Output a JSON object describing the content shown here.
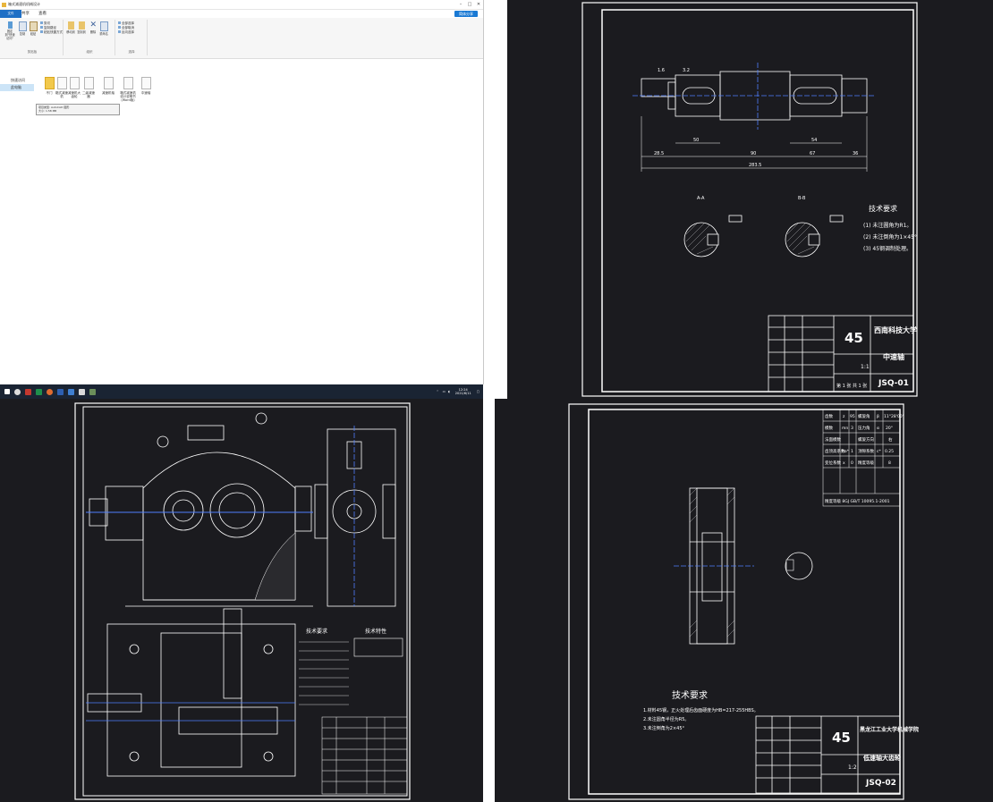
{
  "explorer": {
    "window_title": "箱式减速机机械设计",
    "menu": [
      "文件",
      "主页",
      "共享",
      "查看"
    ],
    "share_button": "简体分享",
    "ribbon": {
      "groups": [
        {
          "label": "剪贴板"
        },
        {
          "label": "组织"
        },
        {
          "label": "选择"
        }
      ],
      "buttons": {
        "pin": "固定到\"快速访问\"",
        "copy": "复制",
        "paste": "粘贴",
        "cut": "剪切",
        "copy_path": "复制路径",
        "paste_shortcut": "粘贴快捷方式",
        "move_to": "移动到",
        "copy_to": "复制到",
        "delete": "删除",
        "rename": "重命名",
        "select_all": "全部选择",
        "select_none": "全部取消",
        "invert_selection": "反向选择"
      }
    },
    "nav": [
      "快速访问",
      "此电脑"
    ],
    "files": [
      {
        "name": "不门",
        "type": "folder"
      },
      {
        "name": "箱式减速机",
        "type": "doc"
      },
      {
        "name": "减速机大齿轮",
        "type": "doc"
      },
      {
        "name": "二级减速器",
        "type": "doc"
      },
      {
        "name": "减速机轴",
        "type": "doc"
      },
      {
        "name": "箱式减速机设计说明书 (Word版)",
        "type": "doc"
      },
      {
        "name": "中速轴",
        "type": "doc"
      }
    ],
    "tooltip": [
      "项目类型: AutoCAD 图形",
      "大小: 1.58 MB",
      "修改日期: 2021/6/11 12:24"
    ]
  },
  "taskbar": {
    "time": "12:24",
    "date": "2021/6/11",
    "icons": [
      "windows-icon",
      "search-icon",
      "cad-icon",
      "excel-icon",
      "browser-icon",
      "word-icon",
      "autocad-icon",
      "folder-icon",
      "app-icon"
    ]
  },
  "shaft_drawing": {
    "material": "45",
    "school": "西南科技大学",
    "part_name": "中速轴",
    "drawing_no": "JSQ-01",
    "scale": "1:1",
    "requirements_title": "技术要求",
    "requirements": [
      "(1) 未注圆角为R1。",
      "(2) 未注倒角为1×45°",
      "(3) 45钢调制处理。"
    ],
    "section_labels": [
      "A-A",
      "B-B"
    ],
    "dims": [
      "28.5",
      "50",
      "90",
      "67",
      "36",
      "283.5",
      "54",
      "1.6",
      "3.2"
    ],
    "sheet": "第 1 张  共 1 张"
  },
  "gear_drawing": {
    "material": "45",
    "school": "黑龙江工业大学机械学院",
    "part_name": "低速轴大齿轮",
    "drawing_no": "JSQ-02",
    "scale": "1:2",
    "requirements_title": "技术要求",
    "requirements": [
      "1.材料45钢，正火处理后齿面硬度为HB=217-255HBS。",
      "2.未注圆角半径为R5。",
      "3.未注倒角为2×45°"
    ],
    "params": [
      [
        "齿数",
        "z",
        "95",
        "螺旋角",
        "β",
        "11°28'00\""
      ],
      [
        "模数",
        "mn",
        "3",
        "压力角",
        "α",
        "20°"
      ],
      [
        "法面模数",
        "",
        "",
        "螺旋方向",
        "",
        "右"
      ],
      [
        "齿顶高系数",
        "ha*",
        "1",
        "顶隙系数",
        "c*",
        "0.25"
      ],
      [
        "变位系数",
        "x",
        "0",
        "精度等级",
        "",
        "8"
      ]
    ],
    "standard": "精度等级 8GJ GB/T 10095.1-2001"
  },
  "assembly_drawing": {
    "requirements_title": "技术要求",
    "characteristics_title": "技术特性"
  }
}
